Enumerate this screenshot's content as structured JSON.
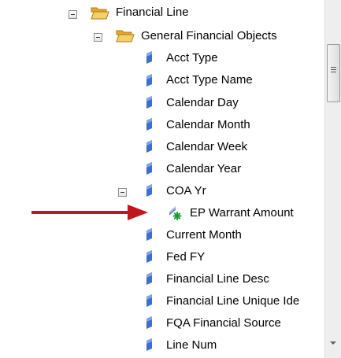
{
  "tree": {
    "items": [
      {
        "label": "Financial Line",
        "kind": "folder",
        "expanded": true
      },
      {
        "label": "General Financial Objects",
        "kind": "folder",
        "expanded": true
      },
      {
        "label": "Acct Type",
        "kind": "dimension"
      },
      {
        "label": "Acct Type Name",
        "kind": "dimension"
      },
      {
        "label": "Calendar Day",
        "kind": "dimension"
      },
      {
        "label": "Calendar Month",
        "kind": "dimension"
      },
      {
        "label": "Calendar Week",
        "kind": "dimension"
      },
      {
        "label": "Calendar Year",
        "kind": "dimension"
      },
      {
        "label": "COA Yr",
        "kind": "dimension",
        "expanded": true
      },
      {
        "label": "EP Warrant Amount",
        "kind": "measure"
      },
      {
        "label": "Current Month",
        "kind": "dimension"
      },
      {
        "label": "Fed FY",
        "kind": "dimension"
      },
      {
        "label": "Financial Line Desc",
        "kind": "dimension"
      },
      {
        "label": "Financial Line Unique Ide",
        "kind": "dimension"
      },
      {
        "label": "FQA Financial Source",
        "kind": "dimension"
      },
      {
        "label": "Line Num",
        "kind": "dimension"
      }
    ]
  },
  "icons": {
    "folder": "folder-open-icon",
    "dimension": "dimension-object-icon",
    "measure": "measure-object-icon",
    "expand": "collapse-toggle-icon"
  },
  "colors": {
    "annotation_arrow": "#c0161c",
    "dimension_icon": "#3b6fd4",
    "folder_icon": "#f2c14e",
    "measure_star": "#1e9a3a"
  }
}
